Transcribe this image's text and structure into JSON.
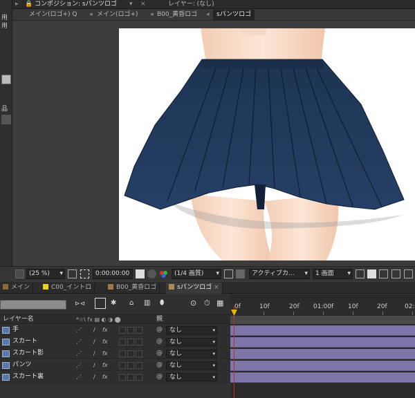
{
  "comp_panel": {
    "title": "コンポジション: sパンツロゴ",
    "layer_tab": "レイヤー: (なし)",
    "subtabs": [
      "メイン(ロゴ+) Q",
      "メイン(ロゴ+)",
      "B00_黄昏ロゴ",
      "sパンツロゴ"
    ],
    "project_strip_text": "用用"
  },
  "viewer_toolbar": {
    "zoom": "(25 %)",
    "timecode": "0:00:00:00",
    "resolution": "(1/4 画質)",
    "camera": "アクティブカ...",
    "views": "1 画面"
  },
  "timeline": {
    "tabs": [
      {
        "label": "メイン",
        "color": "#8a6a3a"
      },
      {
        "label": "C00_イントロ",
        "color": "#e6d21a"
      },
      {
        "label": "B00_黄昏ロゴ",
        "color": "#9a7a4a"
      },
      {
        "label": "sパンツロゴ",
        "color": "#b08a55"
      }
    ],
    "columns": {
      "layer_name": "レイヤー名",
      "parent": "親"
    },
    "ruler": [
      "0f",
      "10f",
      "20f",
      "01:00f",
      "10f",
      "20f",
      "02:"
    ],
    "layers": [
      {
        "name": "手",
        "parent": "なし"
      },
      {
        "name": "スカート",
        "parent": "なし"
      },
      {
        "name": "スカート影",
        "parent": "なし"
      },
      {
        "name": "パンツ",
        "parent": "なし"
      },
      {
        "name": "スカート裏",
        "parent": "なし"
      }
    ],
    "fx_label": "fx"
  },
  "colors": {
    "layer_bar": "#7d76a9",
    "playhead": "#d32020",
    "skirt": "#1e3a5e"
  }
}
